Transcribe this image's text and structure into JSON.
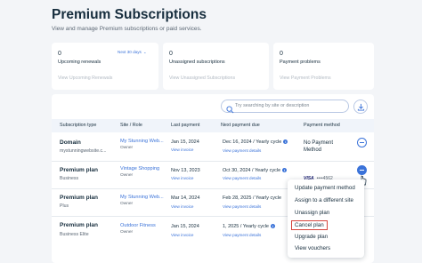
{
  "page": {
    "title": "Premium Subscriptions",
    "subtitle": "View and manage Premium subscriptions or paid services."
  },
  "cards": [
    {
      "count": "0",
      "label": "Upcoming renewals",
      "filter": "Next 30 days",
      "link": "View Upcoming Renewals"
    },
    {
      "count": "0",
      "label": "Unassigned subscriptions",
      "link": "View Unassigned Subscriptions"
    },
    {
      "count": "0",
      "label": "Payment problems",
      "link": "View Payment Problems"
    }
  ],
  "search": {
    "placeholder": "Try searching by site or description"
  },
  "table": {
    "headers": [
      "Subscription type",
      "Site / Role",
      "Last payment",
      "Next payment due",
      "Payment method"
    ],
    "rows": [
      {
        "plan": "Domain",
        "plan_sub": "mystunningwebsite.c...",
        "site": "My Stunning Web...",
        "role": "Owner",
        "last_payment": "Jan 15, 2024",
        "view_invoice": "View invoice",
        "next_payment": "Dec 16, 2024 / Yearly cycle",
        "payment_details": "View payment details",
        "payment_method": "No Payment Method"
      },
      {
        "plan": "Premium plan",
        "plan_sub": "Business",
        "site": "Vintage Shopping",
        "role": "Owner",
        "last_payment": "Nov 13, 2023",
        "view_invoice": "View invoice",
        "next_payment": "Oct 30, 2024 / Yearly cycle",
        "payment_details": "View payment details",
        "card_brand": "VISA",
        "card_mask": "••••4562"
      },
      {
        "plan": "Premium plan",
        "plan_sub": "Plus",
        "site": "My Stunning Web...",
        "role": "Owner",
        "last_payment": "Mar 14, 2024",
        "view_invoice": "View invoice",
        "next_payment": "Feb 28, 2025 / Yearly cycle",
        "payment_details": "View payment details"
      },
      {
        "plan": "Premium plan",
        "plan_sub": "Business Elite",
        "site": "Outdoor Fitness",
        "role": "Owner",
        "last_payment": "Jan 15, 2024",
        "view_invoice": "View invoice",
        "next_payment": "1, 2025 / Yearly cycle",
        "payment_details": "View payment details"
      }
    ]
  },
  "menu": {
    "items": [
      "Update payment method",
      "Assign to a different site",
      "Unassign plan",
      "Cancel plan",
      "Upgrade plan",
      "View vouchers"
    ],
    "highlighted": "Cancel plan"
  },
  "colors": {
    "accent": "#3b73d9",
    "highlight": "#d6453d",
    "background": "#f3f5f8"
  },
  "icons": [
    "search-icon",
    "download-icon",
    "info-icon",
    "more-actions-icon",
    "cursor-icon",
    "chevron-down-icon"
  ]
}
